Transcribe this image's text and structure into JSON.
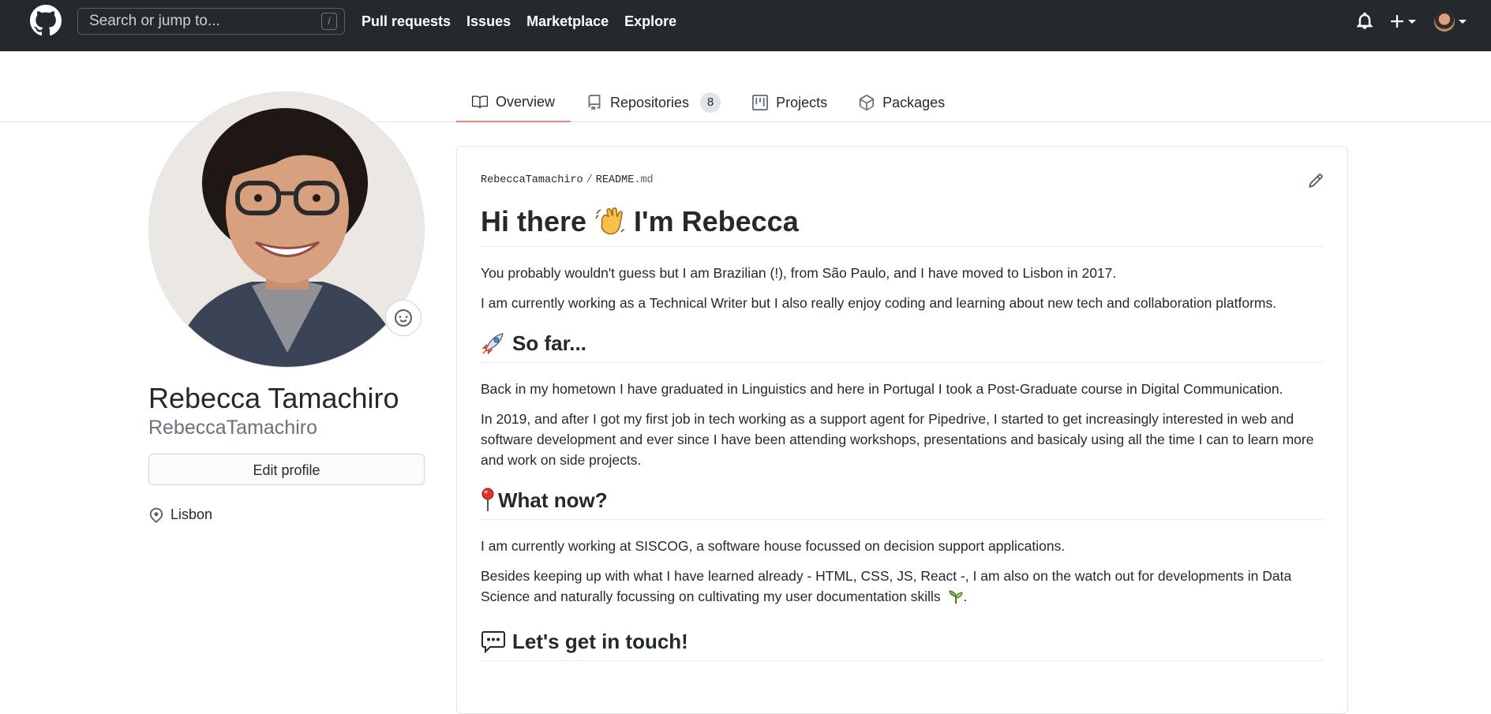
{
  "header": {
    "search_placeholder": "Search or jump to...",
    "search_shortcut": "/",
    "nav": [
      "Pull requests",
      "Issues",
      "Marketplace",
      "Explore"
    ],
    "icons": [
      "bell-icon",
      "plus-icon",
      "caret-down-icon",
      "avatar"
    ]
  },
  "tabs": [
    {
      "label": "Overview",
      "icon": "book-icon",
      "active": true
    },
    {
      "label": "Repositories",
      "icon": "repo-icon",
      "count": "8"
    },
    {
      "label": "Projects",
      "icon": "project-icon"
    },
    {
      "label": "Packages",
      "icon": "package-icon"
    }
  ],
  "profile": {
    "name": "Rebecca Tamachiro",
    "login": "RebeccaTamachiro",
    "edit_label": "Edit profile",
    "location": "Lisbon"
  },
  "readme": {
    "owner": "RebeccaTamachiro",
    "separator": "/",
    "file_name": "README",
    "file_ext": ".md",
    "title_before": "Hi there",
    "title_after": "I'm Rebecca",
    "intro1": "You probably wouldn't guess but I am Brazilian (!), from São Paulo, and I have moved to Lisbon in 2017.",
    "intro2": "I am currently working as a Technical Writer but I also really enjoy coding and learning about new tech and collaboration platforms.",
    "h_sofar": "So far...",
    "sofar1": "Back in my hometown I have graduated in Linguistics and here in Portugal I took a Post-Graduate course in Digital Communication.",
    "sofar2": "In 2019, and after I got my first job in tech working as a support agent for Pipedrive, I started to get increasingly interested in web and software development and ever since I have been attending workshops, presentations and basicaly using all the time I can to learn more and work on side projects.",
    "h_now": "What now?",
    "now1": "I am currently working at SISCOG, a software house focussed on decision support applications.",
    "now2": "Besides keeping up with what I have learned already - HTML, CSS, JS, React -, I am also on the watch out for developments in Data Science and naturally focussing on cultivating my user documentation skills",
    "now2_end": ".",
    "h_touch": "Let's get in touch!"
  },
  "colors": {
    "header_bg": "#24292e",
    "tab_accent": "#f9826c",
    "border": "#e1e4e8"
  }
}
